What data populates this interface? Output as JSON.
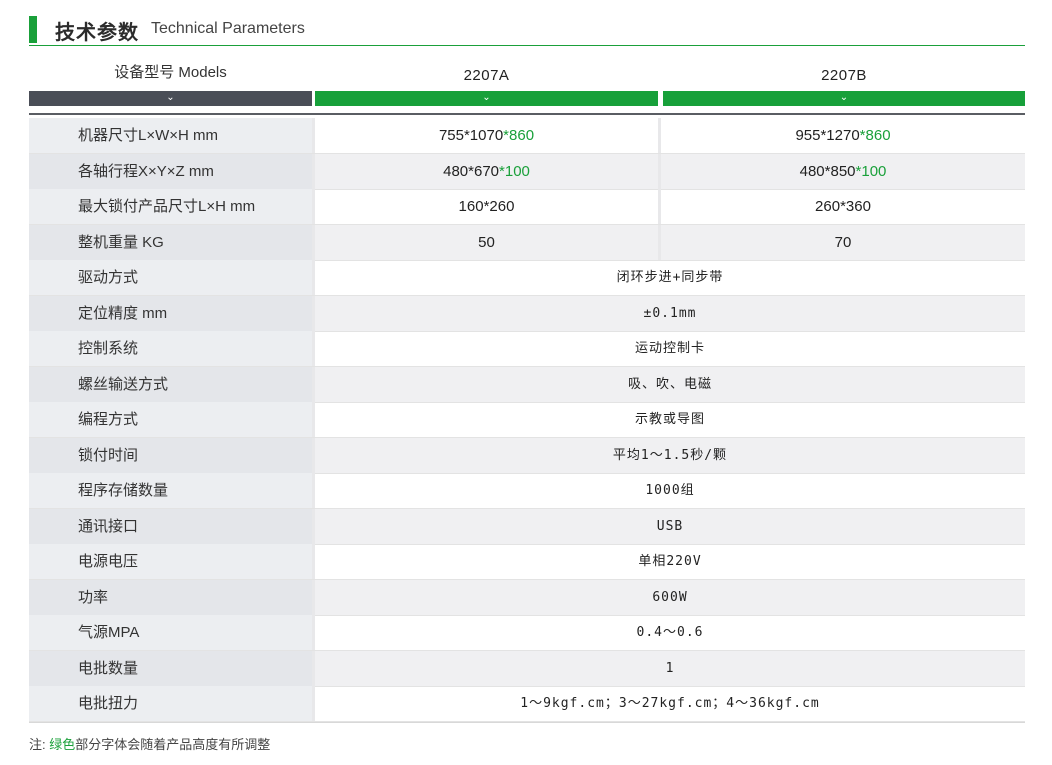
{
  "title": {
    "cn": "技术参数",
    "en": "Technical Parameters"
  },
  "header": {
    "label": "设备型号  Models",
    "col_a": "2207A",
    "col_b": "2207B",
    "arrow": "⌄"
  },
  "rows_split": [
    {
      "label": "机器尺寸L×W×H mm",
      "a_main": "755*1070",
      "a_green": "*860",
      "b_main": "955*1270",
      "b_green": "*860"
    },
    {
      "label": "各轴行程X×Y×Z mm",
      "a_main": "480*670",
      "a_green": "*100",
      "b_main": "480*850",
      "b_green": "*100"
    },
    {
      "label": "最大锁付产品尺寸L×H mm",
      "a_main": "160*260",
      "a_green": "",
      "b_main": "260*360",
      "b_green": ""
    },
    {
      "label": "整机重量 KG",
      "a_main": "50",
      "a_green": "",
      "b_main": "70",
      "b_green": ""
    }
  ],
  "rows_merged": [
    {
      "label": "驱动方式",
      "value": "闭环步进+同步带"
    },
    {
      "label": "定位精度 mm",
      "value": "±0.1mm"
    },
    {
      "label": "控制系统",
      "value": "运动控制卡"
    },
    {
      "label": "螺丝输送方式",
      "value": "吸、吹、电磁"
    },
    {
      "label": "编程方式",
      "value": "示教或导图"
    },
    {
      "label": "锁付时间",
      "value": "平均1～1.5秒/颗"
    },
    {
      "label": "程序存储数量",
      "value": "1000组"
    },
    {
      "label": "通讯接口",
      "value": "USB"
    },
    {
      "label": "电源电压",
      "value": "单相220V"
    },
    {
      "label": "功率",
      "value": "600W"
    },
    {
      "label": "气源MPA",
      "value": "0.4～0.6"
    },
    {
      "label": "电批数量",
      "value": "1"
    },
    {
      "label": "电批扭力",
      "value": "1～9kgf.cm；3～27kgf.cm；4～36kgf.cm"
    }
  ],
  "note": {
    "prefix": "注: ",
    "green": "绿色",
    "rest": "部分字体会随着产品高度有所调整"
  },
  "colors": {
    "accent": "#1aa03a",
    "dark_bar": "#4a4e57"
  }
}
